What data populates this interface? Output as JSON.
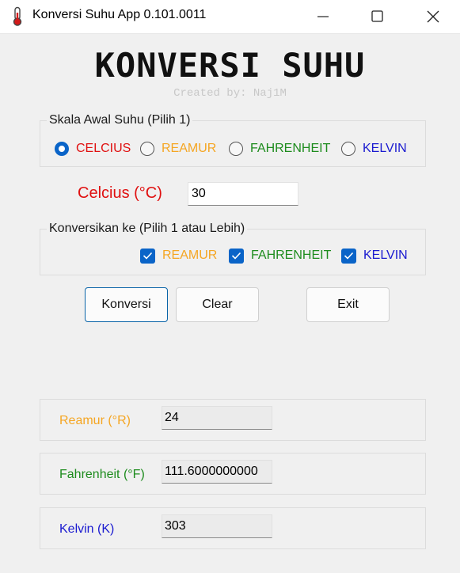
{
  "window": {
    "title": "Konversi Suhu App 0.101.0011",
    "icon": "thermometer-icon"
  },
  "header": {
    "title": "KONVERSI SUHU",
    "subtitle": "Created by: Naj1M"
  },
  "source_scale": {
    "legend": "Skala Awal Suhu (Pilih 1)",
    "options": [
      {
        "label": "CELCIUS",
        "color": "#e01010",
        "selected": true
      },
      {
        "label": "REAMUR",
        "color": "#f5a623",
        "selected": false
      },
      {
        "label": "FAHRENHEIT",
        "color": "#1e8c1e",
        "selected": false
      },
      {
        "label": "KELVIN",
        "color": "#1a1ad0",
        "selected": false
      }
    ]
  },
  "input": {
    "label": "Celcius (°C)",
    "value": "30"
  },
  "target_scales": {
    "legend": "Konversikan ke (Pilih 1 atau Lebih)",
    "options": [
      {
        "label": "REAMUR",
        "color": "#f5a623",
        "checked": true
      },
      {
        "label": "FAHRENHEIT",
        "color": "#1e8c1e",
        "checked": true
      },
      {
        "label": "KELVIN",
        "color": "#1a1ad0",
        "checked": true
      }
    ]
  },
  "buttons": {
    "convert": "Konversi",
    "clear": "Clear",
    "exit": "Exit"
  },
  "results": [
    {
      "label": "Reamur (°R)",
      "value": "24",
      "color": "#f5a623"
    },
    {
      "label": "Fahrenheit (°F)",
      "value": "111.6000000000",
      "color": "#1e8c1e"
    },
    {
      "label": "Kelvin (K)",
      "value": "303",
      "color": "#1a1ad0"
    }
  ]
}
